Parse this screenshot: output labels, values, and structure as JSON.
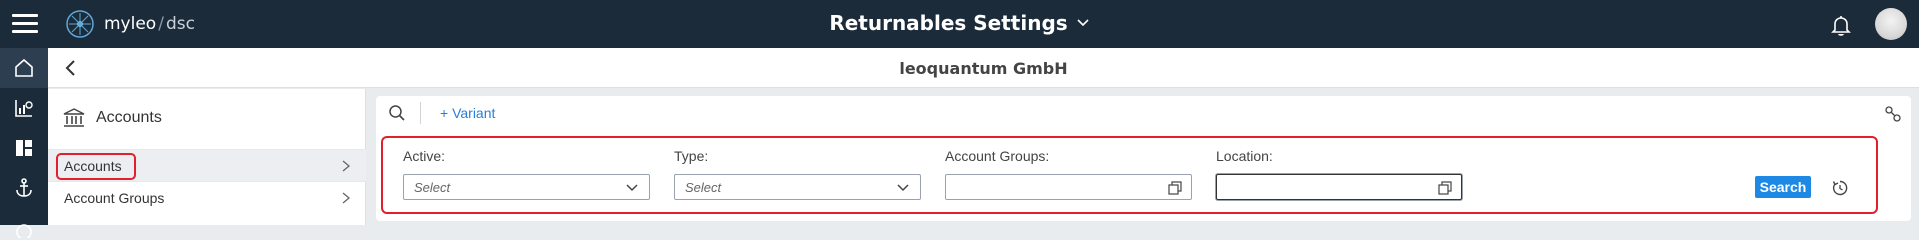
{
  "header": {
    "brand": "myleo",
    "brand_separator": "/",
    "brand_sub": "dsc",
    "title": "Returnables Settings",
    "icons": [
      "menu-icon",
      "myleo-logo-icon",
      "chevron-down-icon",
      "bell-icon",
      "avatar"
    ]
  },
  "rail": {
    "items": [
      {
        "icon": "home-icon"
      },
      {
        "icon": "analytics-icon"
      },
      {
        "icon": "dashboard-icon"
      },
      {
        "icon": "anchor-icon"
      }
    ]
  },
  "subheader": {
    "company": "leoquantum GmbH",
    "back_icon": "chevron-left-icon"
  },
  "left_panel": {
    "title": "Accounts",
    "title_icon": "bank-icon",
    "items": [
      {
        "label": "Accounts",
        "selected": true
      },
      {
        "label": "Account Groups",
        "selected": false
      }
    ]
  },
  "toolbar": {
    "variant_label": "+ Variant",
    "search_icon": "search-icon",
    "settings_icon": "filter-settings-icon"
  },
  "filters": {
    "active": {
      "label": "Active:",
      "placeholder": "Select"
    },
    "type": {
      "label": "Type:",
      "placeholder": "Select"
    },
    "account_groups": {
      "label": "Account Groups:",
      "value": ""
    },
    "location": {
      "label": "Location:",
      "value": ""
    },
    "search_label": "Search",
    "reset_icon": "reset-icon"
  },
  "colors": {
    "topbar": "#1b2b3a",
    "accent": "#1e88e5",
    "link": "#2a7dd6",
    "highlight": "#e0202a"
  }
}
